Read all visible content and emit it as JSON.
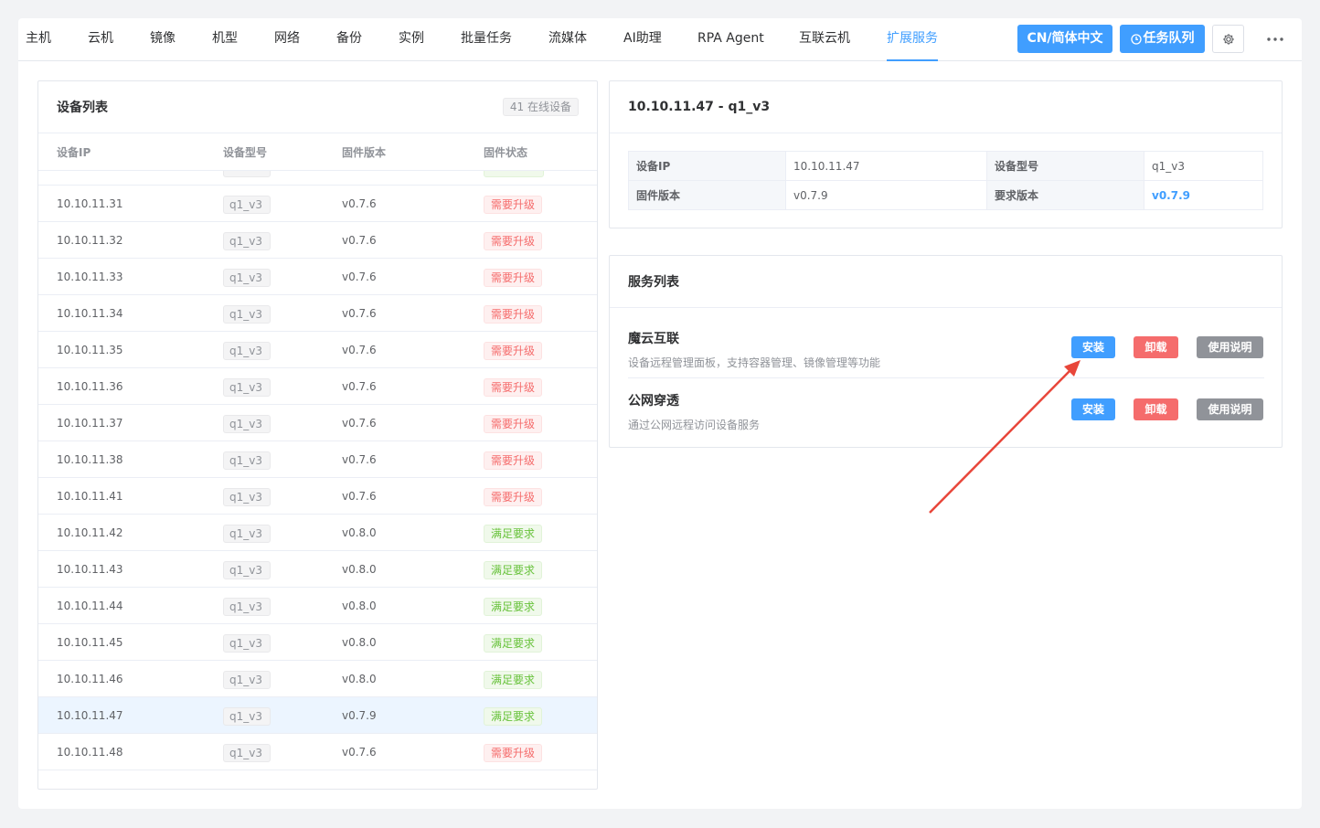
{
  "nav": {
    "tabs": [
      {
        "label": "主机",
        "name": "tab-host"
      },
      {
        "label": "云机",
        "name": "tab-cloud-machine"
      },
      {
        "label": "镜像",
        "name": "tab-image"
      },
      {
        "label": "机型",
        "name": "tab-model"
      },
      {
        "label": "网络",
        "name": "tab-network"
      },
      {
        "label": "备份",
        "name": "tab-backup"
      },
      {
        "label": "实例",
        "name": "tab-instance"
      },
      {
        "label": "批量任务",
        "name": "tab-batch-task"
      },
      {
        "label": "流媒体",
        "name": "tab-streaming"
      },
      {
        "label": "AI助理",
        "name": "tab-ai-assistant"
      },
      {
        "label": "RPA Agent",
        "name": "tab-rpa-agent"
      },
      {
        "label": "互联云机",
        "name": "tab-connected-cloud"
      },
      {
        "label": "扩展服务",
        "name": "tab-extension-service"
      }
    ],
    "active_tab": 12,
    "language_button": "CN/简体中文",
    "task_queue_button": "任务队列"
  },
  "device_list": {
    "title": "设备列表",
    "online_badge": "41 在线设备",
    "columns": [
      "设备IP",
      "设备型号",
      "固件版本",
      "固件状态"
    ],
    "rows": [
      {
        "ip": "10.10.11.31",
        "model": "q1_v3",
        "firmware": "v0.7.6",
        "status": "需要升级",
        "ok": false
      },
      {
        "ip": "10.10.11.32",
        "model": "q1_v3",
        "firmware": "v0.7.6",
        "status": "需要升级",
        "ok": false
      },
      {
        "ip": "10.10.11.33",
        "model": "q1_v3",
        "firmware": "v0.7.6",
        "status": "需要升级",
        "ok": false
      },
      {
        "ip": "10.10.11.34",
        "model": "q1_v3",
        "firmware": "v0.7.6",
        "status": "需要升级",
        "ok": false
      },
      {
        "ip": "10.10.11.35",
        "model": "q1_v3",
        "firmware": "v0.7.6",
        "status": "需要升级",
        "ok": false
      },
      {
        "ip": "10.10.11.36",
        "model": "q1_v3",
        "firmware": "v0.7.6",
        "status": "需要升级",
        "ok": false
      },
      {
        "ip": "10.10.11.37",
        "model": "q1_v3",
        "firmware": "v0.7.6",
        "status": "需要升级",
        "ok": false
      },
      {
        "ip": "10.10.11.38",
        "model": "q1_v3",
        "firmware": "v0.7.6",
        "status": "需要升级",
        "ok": false
      },
      {
        "ip": "10.10.11.41",
        "model": "q1_v3",
        "firmware": "v0.7.6",
        "status": "需要升级",
        "ok": false
      },
      {
        "ip": "10.10.11.42",
        "model": "q1_v3",
        "firmware": "v0.8.0",
        "status": "满足要求",
        "ok": true
      },
      {
        "ip": "10.10.11.43",
        "model": "q1_v3",
        "firmware": "v0.8.0",
        "status": "满足要求",
        "ok": true
      },
      {
        "ip": "10.10.11.44",
        "model": "q1_v3",
        "firmware": "v0.8.0",
        "status": "满足要求",
        "ok": true
      },
      {
        "ip": "10.10.11.45",
        "model": "q1_v3",
        "firmware": "v0.8.0",
        "status": "满足要求",
        "ok": true
      },
      {
        "ip": "10.10.11.46",
        "model": "q1_v3",
        "firmware": "v0.8.0",
        "status": "满足要求",
        "ok": true
      },
      {
        "ip": "10.10.11.47",
        "model": "q1_v3",
        "firmware": "v0.7.9",
        "status": "满足要求",
        "ok": true
      },
      {
        "ip": "10.10.11.48",
        "model": "q1_v3",
        "firmware": "v0.7.6",
        "status": "需要升级",
        "ok": false
      }
    ],
    "selected_row": 14
  },
  "device_detail": {
    "title": "10.10.11.47 - q1_v3",
    "ip_label": "设备IP",
    "ip_value": "10.10.11.47",
    "model_label": "设备型号",
    "model_value": "q1_v3",
    "firmware_label": "固件版本",
    "firmware_value": "v0.7.9",
    "required_label": "要求版本",
    "required_value": "v0.7.9"
  },
  "services": {
    "title": "服务列表",
    "install_label": "安装",
    "uninstall_label": "卸载",
    "guide_label": "使用说明",
    "items": [
      {
        "name": "魔云互联",
        "desc": "设备远程管理面板，支持容器管理、镜像管理等功能"
      },
      {
        "name": "公网穿透",
        "desc": "通过公网远程访问设备服务"
      }
    ]
  },
  "colors": {
    "accent": "#409eff",
    "danger": "#f56c6c",
    "success": "#67c23a",
    "annotation_arrow": "#e8463a"
  }
}
